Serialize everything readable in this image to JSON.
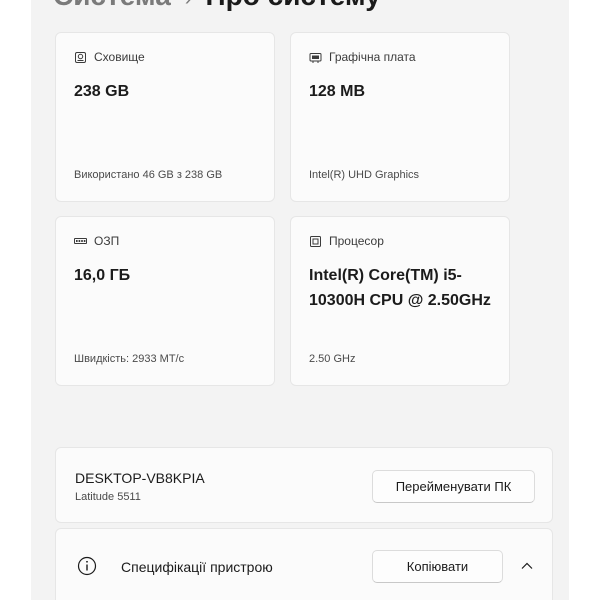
{
  "header": {
    "breadcrumb_parent": "Система",
    "separator": "›",
    "page_title": "Про систему"
  },
  "cards": {
    "storage": {
      "label": "Сховище",
      "value": "238 GB",
      "sub": "Використано 46 GB з 238 GB",
      "icon": "storage-drive-icon"
    },
    "gpu": {
      "label": "Графічна плата",
      "value": "128 MB",
      "sub": "Intel(R) UHD Graphics",
      "icon": "graphics-card-icon"
    },
    "ram": {
      "label": "ОЗП",
      "value": "16,0 ГБ",
      "sub": "Швидкість: 2933 MT/с",
      "icon": "memory-icon"
    },
    "cpu": {
      "label": "Процесор",
      "value": "Intel(R) Core(TM) i5-10300H CPU @ 2.50GHz",
      "sub": "2.50 GHz",
      "icon": "processor-icon"
    }
  },
  "device": {
    "name": "DESKTOP-VB8KPIA",
    "model": "Latitude 5511",
    "rename_label": "Перейменувати ПК"
  },
  "specs": {
    "label": "Специфікації пристрою",
    "copy_label": "Копіювати",
    "info_icon": "info-icon",
    "toggle_icon": "chevron-up-icon"
  },
  "colors": {
    "panel_bg": "#f3f3f3",
    "card_bg": "#fbfbfb",
    "border": "#e6e6e6"
  }
}
